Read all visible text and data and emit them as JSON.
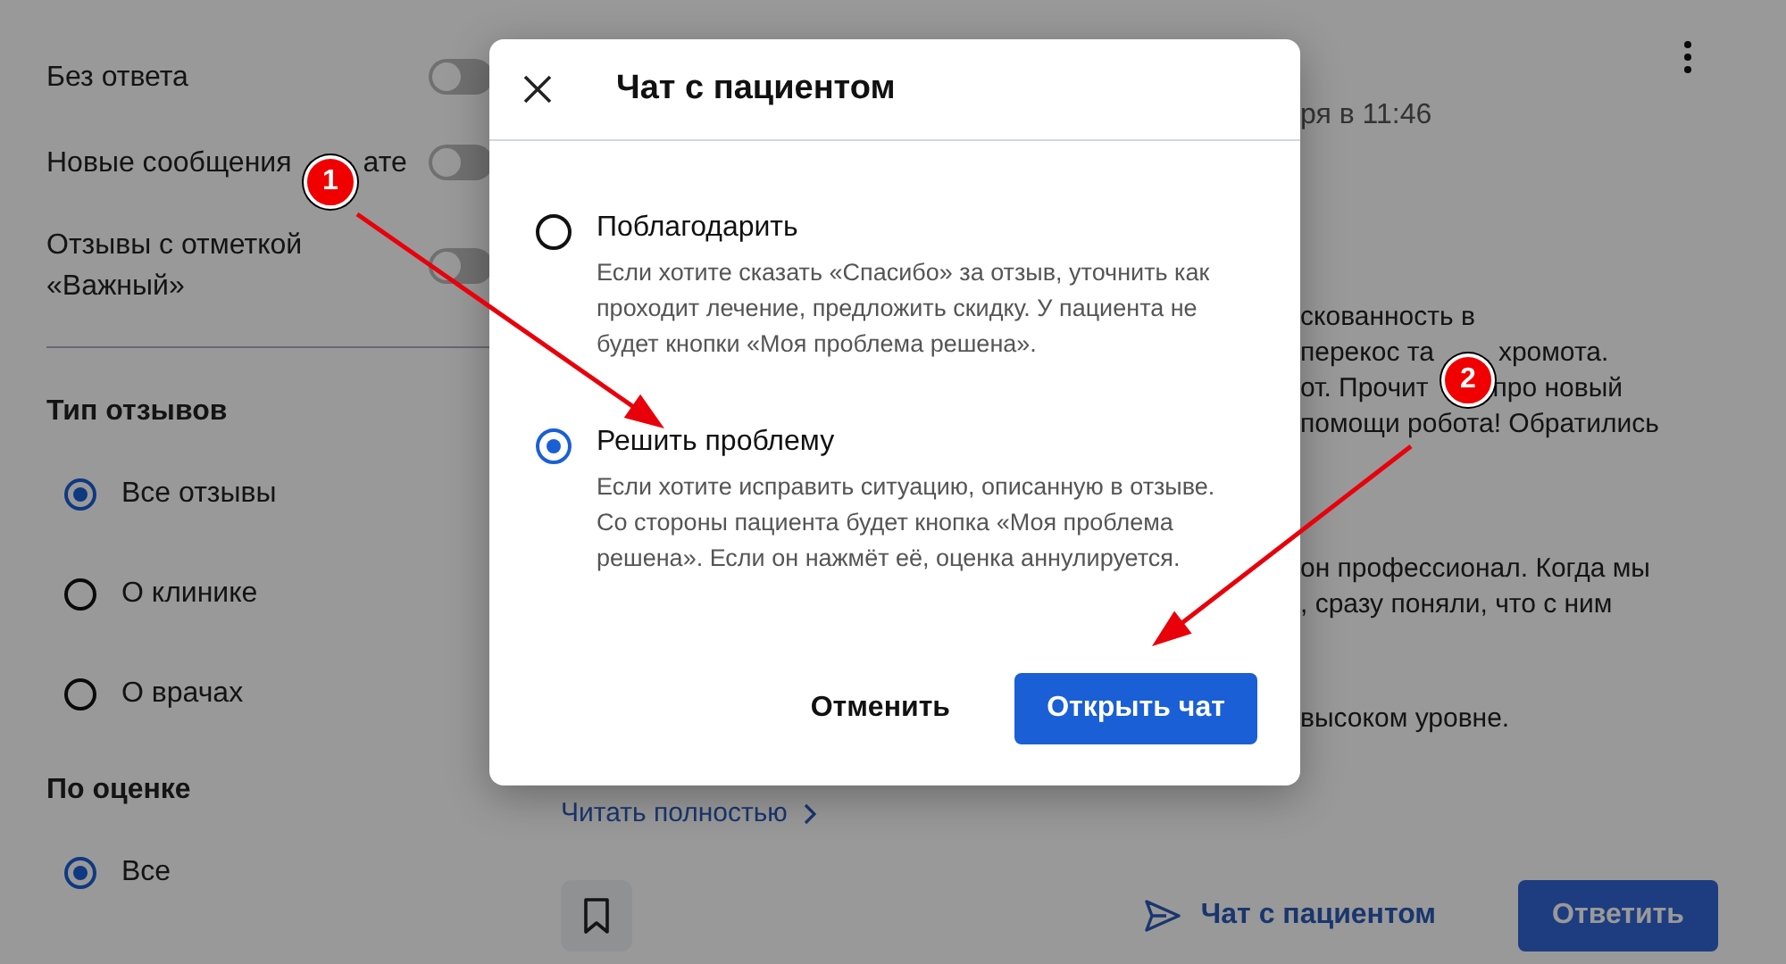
{
  "sidebar": {
    "toggles": [
      {
        "label": [
          "Без ответа"
        ],
        "on": false
      },
      {
        "label": [
          "Новые сообщения",
          "ате"
        ],
        "on": false
      },
      {
        "label": [
          "Отзывы с отметкой «Важный»"
        ],
        "on": false
      }
    ],
    "groups": [
      {
        "title": "Тип отзывов",
        "options": [
          {
            "label": "Все отзывы",
            "selected": true
          },
          {
            "label": "О клинике",
            "selected": false
          },
          {
            "label": "О врачах",
            "selected": false
          }
        ]
      },
      {
        "title": "По оценке",
        "options": [
          {
            "label": "Все",
            "selected": true
          }
        ]
      }
    ]
  },
  "review": {
    "date_fragment": "ря в 11:46",
    "paragraphs": [
      [
        [
          "скованность в"
        ],
        [
          "перекос та",
          "хромота."
        ],
        [
          "от. Прочит",
          "про новый"
        ],
        [
          "помощи робота! Обратились"
        ]
      ],
      [
        [
          "он профессионал. Когда мы"
        ],
        [
          ", сразу поняли, что с ним"
        ]
      ],
      [
        [
          "высоком уровне."
        ]
      ]
    ],
    "read_more": "Читать полностью",
    "chat_link": "Чат с пациентом",
    "reply_button": "Ответить"
  },
  "dialog": {
    "title": "Чат с пациентом",
    "options": [
      {
        "label": "Поблагодарить",
        "description": "Если хотите сказать «Спасибо» за отзыв, уточнить как проходит лечение, предложить скидку. У пациента не будет кнопки «Моя проблема решена».",
        "selected": false
      },
      {
        "label": "Решить проблему",
        "description": "Если хотите исправить ситуацию, описанную в отзыве. Со стороны пациента будет кнопка «Моя проблема решена». Если он нажмёт её, оценка аннулируется.",
        "selected": true
      }
    ],
    "cancel_button": "Отменить",
    "confirm_button": "Открыть чат"
  },
  "annotations": [
    {
      "label": "1"
    },
    {
      "label": "2"
    }
  ]
}
